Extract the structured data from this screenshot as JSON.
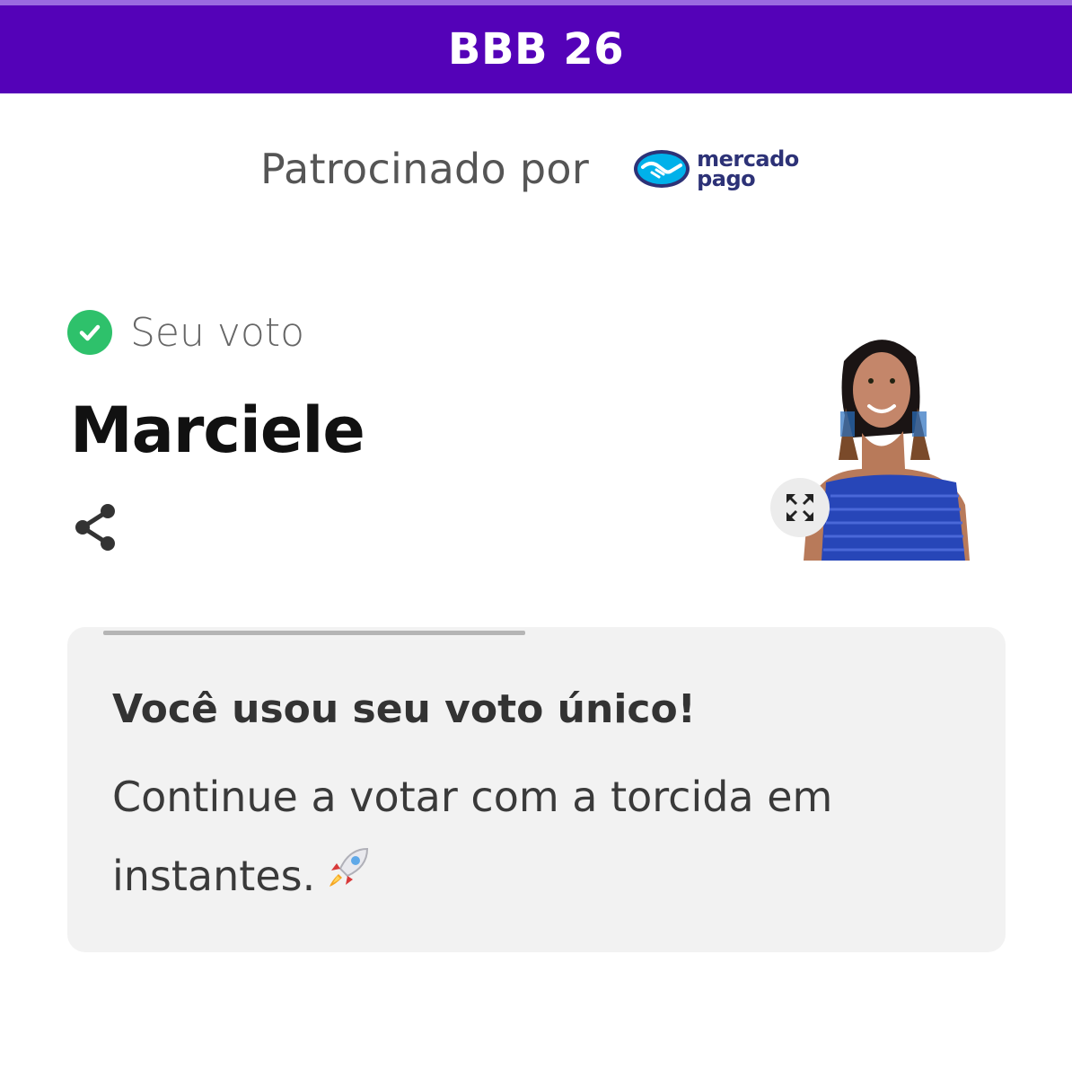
{
  "header": {
    "title": "BBB 26",
    "color": "#5402b8"
  },
  "sponsor": {
    "label": "Patrocinado por",
    "logo_line1": "mercado",
    "logo_line2": "pago",
    "logo_icon": "handshake-icon"
  },
  "vote": {
    "status_icon": "check-circle-icon",
    "status_label": "Seu voto",
    "candidate_name": "Marciele",
    "share_icon": "share-icon",
    "expand_icon": "expand-icon"
  },
  "message": {
    "heading": "Você usou seu voto único!",
    "body": "Continue a votar com a torcida em instantes.",
    "emoji_icon": "rocket-icon"
  },
  "colors": {
    "accent": "#5402b8",
    "success": "#2ec16b",
    "card_background": "#f2f2f2"
  }
}
